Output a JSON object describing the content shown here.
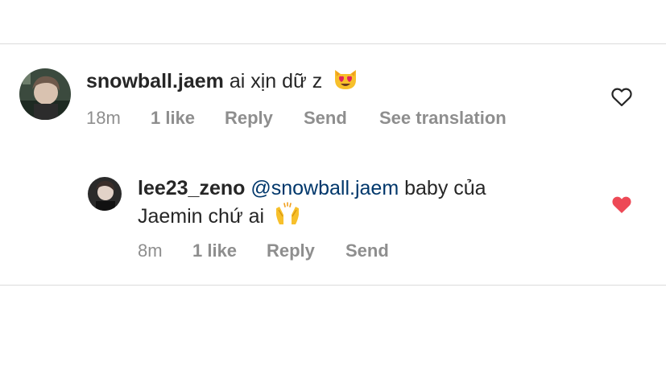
{
  "comments": [
    {
      "username": "snowball.jaem",
      "text": "ai xịn dữ z",
      "emoji": "heart-eyes-cat-emoji",
      "time": "18m",
      "likes": "1 like",
      "reply": "Reply",
      "send": "Send",
      "see_translation": "See translation",
      "liked": false
    },
    {
      "username": "lee23_zeno",
      "mention": "@snowball.jaem",
      "text_line1": "baby của",
      "text_line2": "Jaemin chứ ai",
      "emoji": "raising-hands-emoji",
      "time": "8m",
      "likes": "1 like",
      "reply": "Reply",
      "send": "Send",
      "liked": true
    }
  ],
  "colors": {
    "text": "#262626",
    "meta": "#8e8e8e",
    "mention": "#00376b",
    "liked_heart": "#ed4956",
    "divider": "#dbdbdb"
  }
}
